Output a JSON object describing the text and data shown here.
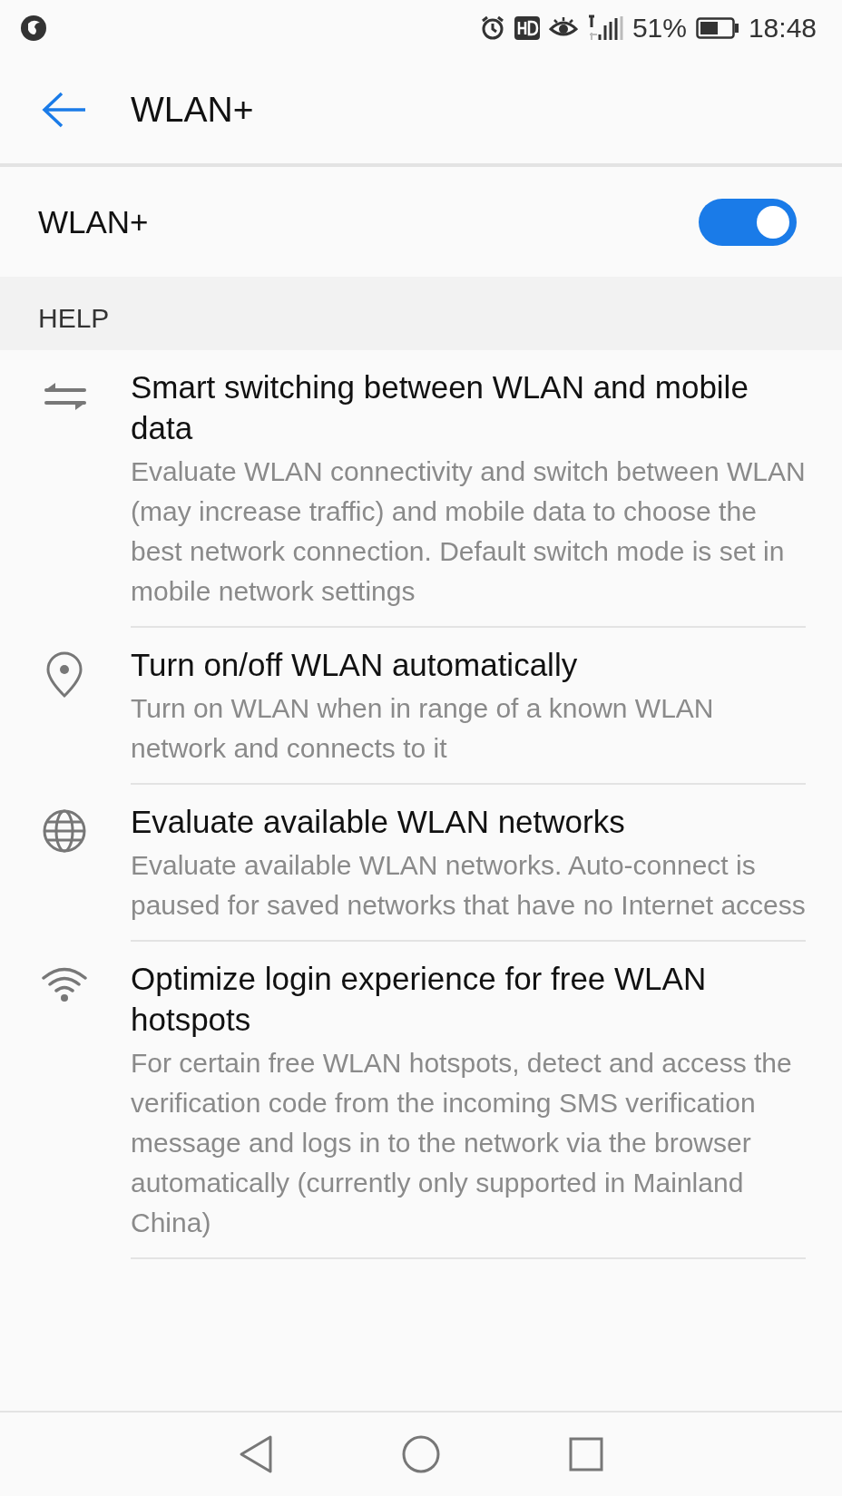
{
  "status_bar": {
    "battery_percent": "51%",
    "time": "18:48"
  },
  "app_bar": {
    "title": "WLAN+"
  },
  "toggle": {
    "label": "WLAN+",
    "on": true
  },
  "section_header": "HELP",
  "items": [
    {
      "kind": "swap",
      "title": "Smart switching between WLAN and mobile data",
      "description": "Evaluate WLAN connectivity and switch between WLAN (may increase traffic) and mobile data to choose the best network connection. Default switch mode is set in mobile network settings"
    },
    {
      "kind": "location",
      "title": "Turn on/off WLAN automatically",
      "description": "Turn on WLAN when in range of a known WLAN network and connects to it"
    },
    {
      "kind": "globe",
      "title": "Evaluate available WLAN networks",
      "description": "Evaluate available WLAN networks. Auto-connect is paused for saved networks that have no Internet access"
    },
    {
      "kind": "wifi",
      "title": "Optimize login experience for free WLAN hotspots",
      "description": "For certain free WLAN hotspots, detect and access the verification code from the incoming SMS verification message and logs in to the network via the browser automatically (currently only supported in Mainland China)"
    }
  ]
}
